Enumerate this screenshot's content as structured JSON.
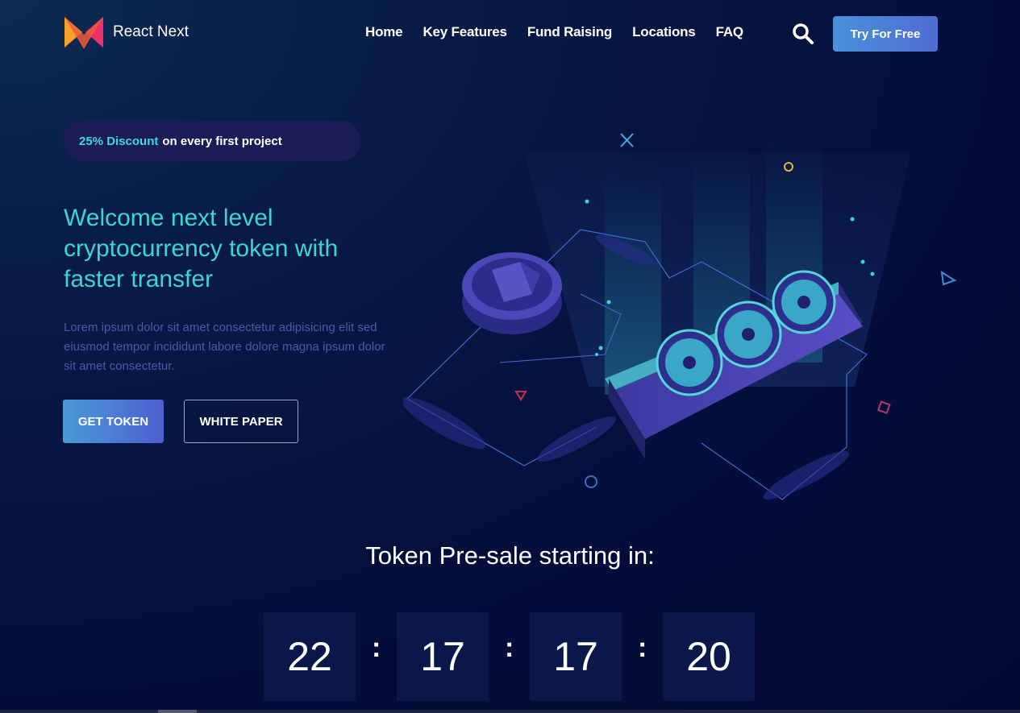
{
  "brand": {
    "name": "React Next",
    "accent": "#3cd4d4"
  },
  "nav": {
    "items": [
      "Home",
      "Key Features",
      "Fund Raising",
      "Locations",
      "FAQ"
    ],
    "search_icon": "search-icon",
    "cta_label": "Try For Free"
  },
  "hero": {
    "discount_highlight": "25% Discount",
    "discount_text": "on every first project",
    "headline": "Welcome next level cryptocurrency token with faster transfer",
    "description": "Lorem ipsum dolor sit amet consectetur adipisicing elit sed eiusmod tempor incididunt labore dolore magna ipsum dolor sit amet consectetur.",
    "primary_button": "GET TOKEN",
    "secondary_button": "WHITE PAPER"
  },
  "presale": {
    "title": "Token Pre-sale starting in:",
    "countdown": [
      "22",
      "17",
      "17",
      "20"
    ],
    "separator": ":"
  }
}
